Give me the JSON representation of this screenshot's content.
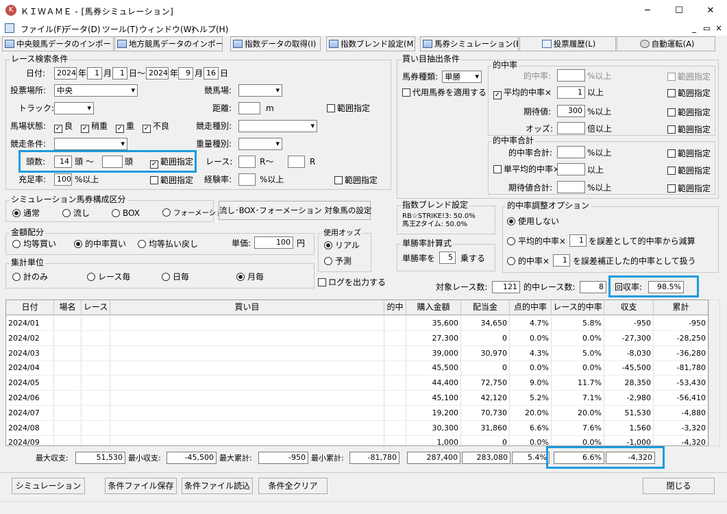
{
  "window": {
    "icon": "kiwame-app-icon",
    "title": "ＫＩＷＡＭＥ - [馬券シミュレーション]",
    "minimize": "─",
    "maximize": "☐",
    "close": "✕"
  },
  "menu": {
    "items": [
      "ファイル(F)",
      "データ(D)",
      "ツール(T)",
      "ウィンドウ(W)",
      "ヘルプ(H)"
    ],
    "min": "_",
    "restore": "▭",
    "close": "×"
  },
  "toolbar": {
    "buttons": [
      "中央競馬データのインポート(J)",
      "地方競馬データのインポート(N)",
      "指数データの取得(I)",
      "指数ブレンド設定(M)",
      "馬券シミュレーション(B)",
      "投票履歴(L)",
      "自動運転(A)"
    ]
  },
  "race_search": {
    "title": "レース検索条件",
    "date_label": "日付:",
    "from_year": "2024",
    "from_month": "1",
    "from_day": "1",
    "to_year": "2024",
    "to_month": "9",
    "to_day": "16",
    "year_unit": "年",
    "month_unit": "月",
    "day_unit": "日",
    "range_sep": "日〜",
    "venue_label": "投票場所:",
    "venue_value": "中央",
    "track_label": "トラック:",
    "track_value": "",
    "condition_label": "馬場状態:",
    "conditions": [
      "良",
      "稍重",
      "重",
      "不良"
    ],
    "race_cond_label": "競走条件:",
    "race_cond_value": "",
    "head_label": "頭数:",
    "head_from": "14",
    "head_unit1": "頭 〜",
    "head_to": "",
    "head_unit2": "頭",
    "head_range": "範囲指定",
    "fill_label": "充足率:",
    "fill_value": "100",
    "fill_unit": "%以上",
    "fill_range": "範囲指定",
    "course_label": "競馬場:",
    "course_value": "",
    "distance_label": "距離:",
    "distance_value": "",
    "distance_unit": "m",
    "distance_range": "範囲指定",
    "race_type_label": "競走種別:",
    "race_type_value": "",
    "weight_label": "重量種別:",
    "weight_value": "",
    "race_label": "レース:",
    "race_from": "",
    "race_unit1": "R〜",
    "race_to": "",
    "race_unit2": "R",
    "exp_label": "経験率:",
    "exp_value": "",
    "exp_unit": "%以上",
    "exp_range": "範囲指定"
  },
  "sim_type": {
    "title": "シミュレーション馬券構成区分",
    "options": [
      "通常",
      "流し",
      "BOX",
      "フォーメーション"
    ],
    "selected": 0,
    "setup_button": "流し･BOX･フォーメーション 対象馬の設定"
  },
  "amount": {
    "title": "金額配分",
    "options": [
      "均等買い",
      "的中率買い",
      "均等払い戻し"
    ],
    "selected": 1,
    "unit_label": "単価:",
    "unit_value": "100",
    "yen": "円"
  },
  "odds": {
    "title": "使用オッズ",
    "options": [
      "リアル",
      "予測"
    ],
    "selected": 0
  },
  "aggregate": {
    "title": "集計単位",
    "options": [
      "計のみ",
      "レース毎",
      "日毎",
      "月毎"
    ],
    "selected": 3
  },
  "log_check": "ログを出力する",
  "buy_cond": {
    "title": "買い目抽出条件",
    "ticket_label": "馬券種類:",
    "ticket_value": "単勝",
    "substitute": "代用馬券を適用する",
    "hit_title": "的中率",
    "hit_rate_label": "的中率:",
    "hit_rate_unit": "%以上",
    "avg_hit_label": "平均的中率×",
    "avg_hit_value": "1",
    "avg_hit_unit": "以上",
    "exp_label": "期待値:",
    "exp_value": "300",
    "exp_unit": "%以上",
    "odds_label": "オッズ:",
    "odds_unit": "倍以上",
    "range": "範囲指定",
    "sum_title": "的中率合計",
    "sum_label": "的中率合計:",
    "sum_unit": "%以上",
    "single_avg_label": "単平均的中率×",
    "single_avg_unit": "以上",
    "exp_sum_label": "期待値合計:",
    "exp_sum_unit": "%以上"
  },
  "blend": {
    "title": "指数ブレンド設定",
    "line1": "RB☆STRIKE!3: 50.0%",
    "line2": "馬王Zタイム: 50.0%"
  },
  "win_calc": {
    "title": "単勝率計算式",
    "label": "単勝率を",
    "value": "5",
    "unit": "乗する"
  },
  "hit_adjust": {
    "title": "的中率調整オプション",
    "opt1": "使用しない",
    "opt2a": "平均的中率×",
    "opt2v": "1",
    "opt2b": "を誤差として的中率から減算",
    "opt3a": "的中率×",
    "opt3v": "1",
    "opt3b": "を誤差補正した的中率として扱う",
    "selected": 0
  },
  "summary": {
    "target_label": "対象レース数:",
    "target_value": "121",
    "hit_label": "的中レース数:",
    "hit_value": "8",
    "return_label": "回収率:",
    "return_value": "98.5%"
  },
  "table": {
    "headers": [
      "日付",
      "場名",
      "レース",
      "買い目",
      "的中",
      "購入金額",
      "配当金",
      "点的中率",
      "レース的中率",
      "収支",
      "累計"
    ],
    "rows": [
      [
        "2024/01",
        "",
        "",
        "",
        "",
        "35,600",
        "34,650",
        "4.7%",
        "5.8%",
        "-950",
        "-950"
      ],
      [
        "2024/02",
        "",
        "",
        "",
        "",
        "27,300",
        "0",
        "0.0%",
        "0.0%",
        "-27,300",
        "-28,250"
      ],
      [
        "2024/03",
        "",
        "",
        "",
        "",
        "39,000",
        "30,970",
        "4.3%",
        "5.0%",
        "-8,030",
        "-36,280"
      ],
      [
        "2024/04",
        "",
        "",
        "",
        "",
        "45,500",
        "0",
        "0.0%",
        "0.0%",
        "-45,500",
        "-81,780"
      ],
      [
        "2024/05",
        "",
        "",
        "",
        "",
        "44,400",
        "72,750",
        "9.0%",
        "11.7%",
        "28,350",
        "-53,430"
      ],
      [
        "2024/06",
        "",
        "",
        "",
        "",
        "45,100",
        "42,120",
        "5.2%",
        "7.1%",
        "-2,980",
        "-56,410"
      ],
      [
        "2024/07",
        "",
        "",
        "",
        "",
        "19,200",
        "70,730",
        "20.0%",
        "20.0%",
        "51,530",
        "-4,880"
      ],
      [
        "2024/08",
        "",
        "",
        "",
        "",
        "30,300",
        "31,860",
        "6.6%",
        "7.6%",
        "1,560",
        "-3,320"
      ],
      [
        "2024/09",
        "",
        "",
        "",
        "",
        "1,000",
        "0",
        "0.0%",
        "0.0%",
        "-1,000",
        "-4,320"
      ]
    ]
  },
  "totals": {
    "max_income_label": "最大収支:",
    "max_income": "51,530",
    "min_income_label": "最小収支:",
    "min_income": "-45,500",
    "max_cum_label": "最大累計:",
    "max_cum": "-950",
    "min_cum_label": "最小累計:",
    "min_cum": "-81,780",
    "purchase": "287,400",
    "payout": "283,080",
    "point_rate": "5.4%",
    "race_rate": "6.6%",
    "balance": "-4,320"
  },
  "footer_buttons": {
    "simulate": "シミュレーション",
    "save": "条件ファイル保存",
    "load": "条件ファイル読込",
    "clear": "条件全クリア",
    "close": "閉じる"
  }
}
